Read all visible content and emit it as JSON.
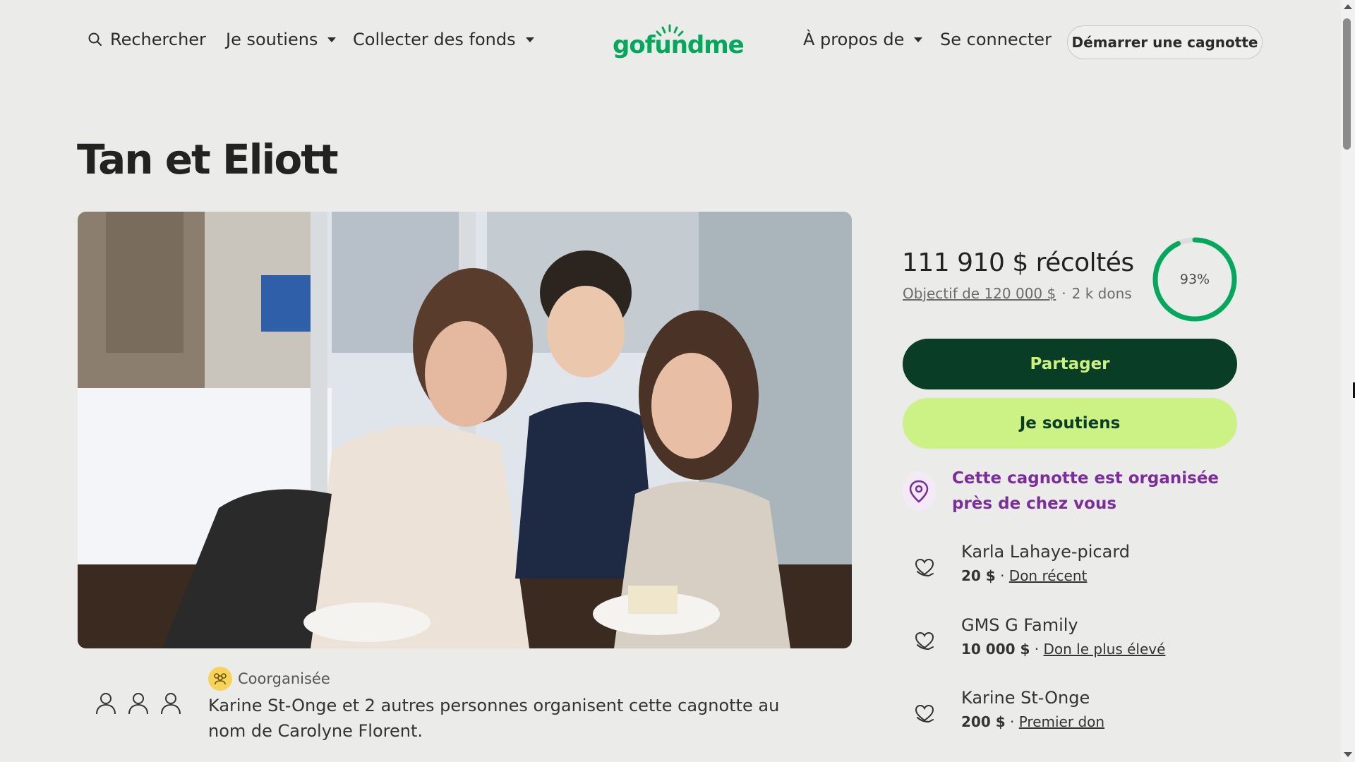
{
  "header": {
    "search_label": "Rechercher",
    "donate_menu": "Je soutiens",
    "fundraise_menu": "Collecter des fonds",
    "logo_text": "gofundme",
    "about_menu": "À propos de",
    "login_label": "Se connecter",
    "start_button": "Démarrer une cagnotte"
  },
  "campaign": {
    "title": "Tan et Eliott",
    "raised": "111 910 $ récoltés",
    "goal": "Objectif de 120 000 $",
    "donations_count": "2 k dons",
    "progress_percent": 93,
    "progress_label": "93%",
    "share_button": "Partager",
    "donate_button": "Je soutiens",
    "local_notice": "Cette cagnotte est organisée près de chez vous"
  },
  "donations": [
    {
      "name": "Karla Lahaye-picard",
      "amount": "20 $",
      "tag": "Don récent"
    },
    {
      "name": "GMS G Family",
      "amount": "10 000 $",
      "tag": "Don le plus élevé"
    },
    {
      "name": "Karine St-Onge",
      "amount": "200 $",
      "tag": "Premier don"
    }
  ],
  "organizers": {
    "badge": "Coorganisée",
    "text": "Karine St-Onge et 2 autres personnes organisent cette cagnotte au nom de Carolyne Florent."
  },
  "colors": {
    "brand_green": "#02a95c",
    "dark_green": "#0a3d25",
    "lime": "#ccf285",
    "purple": "#7a2d9b"
  },
  "icons": [
    "search-icon",
    "caret-down-icon",
    "location-pin-icon",
    "heart-hand-icon",
    "person-icon",
    "group-icon"
  ]
}
